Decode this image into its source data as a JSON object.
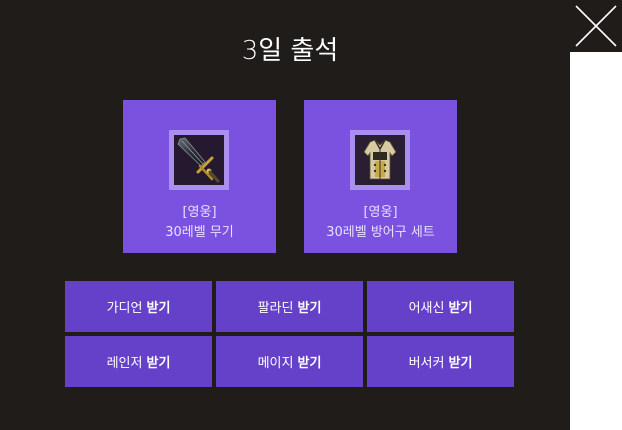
{
  "title": "3일 출석",
  "rewards": [
    {
      "grade": "[영웅]",
      "name": "30레벨 무기",
      "icon": "sword-icon"
    },
    {
      "grade": "[영웅]",
      "name": "30레벨 방어구 세트",
      "icon": "armor-icon"
    }
  ],
  "buttons": [
    {
      "class": "가디언",
      "action": "받기"
    },
    {
      "class": "팔라딘",
      "action": "받기"
    },
    {
      "class": "어새신",
      "action": "받기"
    },
    {
      "class": "레인저",
      "action": "받기"
    },
    {
      "class": "메이지",
      "action": "받기"
    },
    {
      "class": "버서커",
      "action": "받기"
    }
  ],
  "close": {
    "icon": "close-icon"
  },
  "colors": {
    "panel_bg": "#1f1c19",
    "reward_bg": "#7b52e0",
    "button_bg": "#6540c8"
  }
}
